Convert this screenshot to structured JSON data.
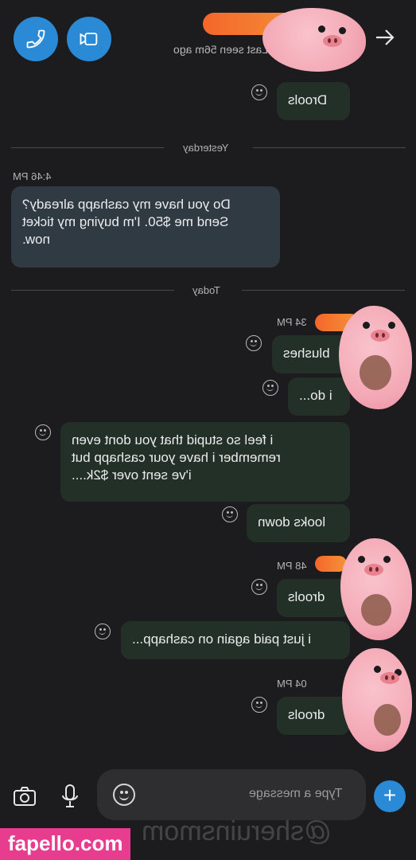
{
  "header": {
    "last_seen": "Last seen 56m ago",
    "call_icon": "phone-icon",
    "video_icon": "video-icon",
    "forward_icon": "arrow-right-icon"
  },
  "dividers": {
    "yesterday": "Yesterday",
    "today": "Today"
  },
  "messages": [
    {
      "side": "out",
      "text": "Drools"
    },
    {
      "side": "in",
      "time": "4:46 PM",
      "text": "Do you have my cashapp already?\nSend me $50. I'm buying my ticket\nnow."
    },
    {
      "side": "out",
      "time": "34 PM",
      "text": "blushes"
    },
    {
      "side": "out",
      "text": "i do..."
    },
    {
      "side": "out",
      "text": "i feel so stupid that you dont even\nremember i have your cashapp but\ni've sent over $2k...."
    },
    {
      "side": "out",
      "text": "looks down"
    },
    {
      "side": "out",
      "time": "48 PM",
      "text": "drools"
    },
    {
      "side": "out",
      "text": "i just paid again on cashapp..."
    },
    {
      "side": "out",
      "time": "04 PM",
      "text": "drools"
    }
  ],
  "composer": {
    "placeholder": "Type a message",
    "add_label": "+"
  },
  "watermarks": {
    "user": "@sheruinsmom",
    "site": "fapello.com"
  },
  "colors": {
    "accent": "#2a8ad6",
    "background": "#1c1c1e",
    "outgoing_bubble": "#233027",
    "incoming_bubble": "#2f3a43"
  }
}
